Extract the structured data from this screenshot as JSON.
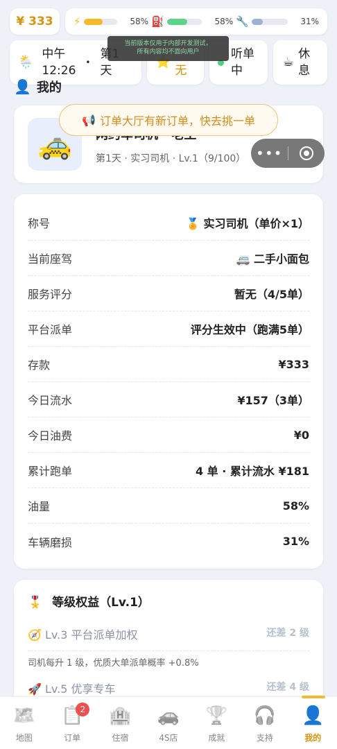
{
  "status": {
    "money": "¥ 333",
    "energy_icon": "lightning-icon",
    "energy_pct": "58%",
    "energy_level": 0.58,
    "fuel_icon": "fuel-pump-icon",
    "fuel_pct": "58%",
    "fuel_level": 0.58,
    "wear_icon": "wrench-icon",
    "wear_pct": "31%",
    "wear_level": 0.31
  },
  "row2": {
    "time_line1": "中午",
    "time_line2": "12:26",
    "day_line1": "第1",
    "day_line2": "天",
    "mood_line2": "无",
    "listen_line1": "听单",
    "listen_line2": "中",
    "rest_line1": "休",
    "rest_line2": "息"
  },
  "dev_toast": {
    "line1": "当前版本仅用于内部开发测试，",
    "line2": "所有内容均不面向用户"
  },
  "section": {
    "title": "我的"
  },
  "profile": {
    "name": "网约车司机 · 老王",
    "sub": "第1天 · 实习司机 · Lv.1（9/100）"
  },
  "order_toast": "订单大厅有新订单，快去挑一单",
  "info": {
    "rows": [
      {
        "label": "称号",
        "value": "🏅 实习司机（单价×1）"
      },
      {
        "label": "当前座驾",
        "value": "🚐 二手小面包"
      },
      {
        "label": "服务评分",
        "value": "暂无（4/5单）"
      },
      {
        "label": "平台派单",
        "value": "评分生效中（跑满5单）"
      },
      {
        "label": "存款",
        "value": "¥333"
      },
      {
        "label": "今日流水",
        "value": "¥157（3单）"
      },
      {
        "label": "今日油费",
        "value": "¥0"
      },
      {
        "label": "累计跑单",
        "value": "4 单 · 累计流水 ¥181"
      },
      {
        "label": "油量",
        "value": "58%"
      },
      {
        "label": "车辆磨损",
        "value": "31%"
      }
    ]
  },
  "rights": {
    "title": "等级权益（Lv.1）",
    "items": [
      {
        "name": "Lv.3 平台派单加权",
        "need": "还差 2 级",
        "desc": "司机每升 1 级，优质大单派单概率 +0.8%"
      },
      {
        "name": "Lv.5 优享专车",
        "need": "还差 4 级"
      }
    ]
  },
  "tabs": [
    {
      "label": "地图",
      "icon": "map-icon"
    },
    {
      "label": "订单",
      "icon": "clipboard-icon",
      "badge": "2"
    },
    {
      "label": "住宿",
      "icon": "hotel-icon"
    },
    {
      "label": "4S店",
      "icon": "car-icon"
    },
    {
      "label": "成就",
      "icon": "trophy-icon"
    },
    {
      "label": "支持",
      "icon": "headphones-icon"
    },
    {
      "label": "我的",
      "icon": "user-icon",
      "active": true
    }
  ]
}
